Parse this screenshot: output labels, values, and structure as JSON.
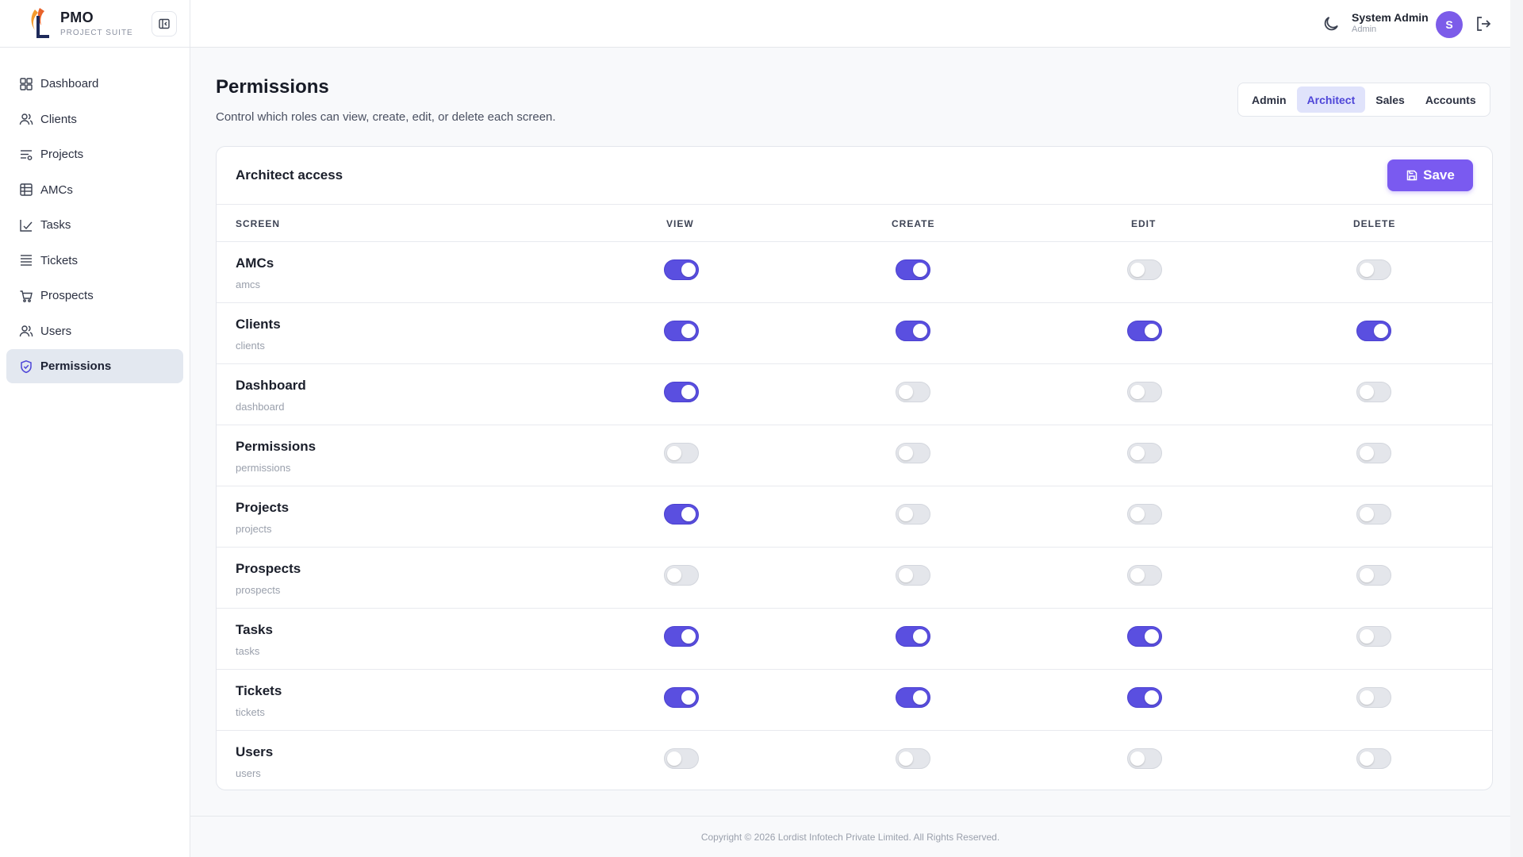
{
  "brand": {
    "title": "PMO",
    "subtitle": "PROJECT SUITE"
  },
  "sidebar": {
    "items": [
      {
        "label": "Dashboard",
        "icon": "grid-icon",
        "active": false
      },
      {
        "label": "Clients",
        "icon": "users-icon",
        "active": false
      },
      {
        "label": "Projects",
        "icon": "projects-icon",
        "active": false
      },
      {
        "label": "AMCs",
        "icon": "table-icon",
        "active": false
      },
      {
        "label": "Tasks",
        "icon": "checklist-icon",
        "active": false
      },
      {
        "label": "Tickets",
        "icon": "tickets-icon",
        "active": false
      },
      {
        "label": "Prospects",
        "icon": "cart-icon",
        "active": false
      },
      {
        "label": "Users",
        "icon": "users-icon",
        "active": false
      },
      {
        "label": "Permissions",
        "icon": "shield-icon",
        "active": true
      }
    ]
  },
  "header": {
    "user_name": "System Admin",
    "user_role": "Admin",
    "avatar_initial": "S"
  },
  "page": {
    "title": "Permissions",
    "description": "Control which roles can view, create, edit, or delete each screen."
  },
  "roles": [
    {
      "label": "Admin",
      "active": false
    },
    {
      "label": "Architect",
      "active": true
    },
    {
      "label": "Sales",
      "active": false
    },
    {
      "label": "Accounts",
      "active": false
    }
  ],
  "card": {
    "title": "Architect access",
    "save_label": "Save",
    "columns": [
      "SCREEN",
      "VIEW",
      "CREATE",
      "EDIT",
      "DELETE"
    ]
  },
  "permissions": [
    {
      "name": "AMCs",
      "key": "amcs",
      "view": true,
      "create": true,
      "edit": false,
      "delete": false
    },
    {
      "name": "Clients",
      "key": "clients",
      "view": true,
      "create": true,
      "edit": true,
      "delete": true
    },
    {
      "name": "Dashboard",
      "key": "dashboard",
      "view": true,
      "create": false,
      "edit": false,
      "delete": false
    },
    {
      "name": "Permissions",
      "key": "permissions",
      "view": false,
      "create": false,
      "edit": false,
      "delete": false
    },
    {
      "name": "Projects",
      "key": "projects",
      "view": true,
      "create": false,
      "edit": false,
      "delete": false
    },
    {
      "name": "Prospects",
      "key": "prospects",
      "view": false,
      "create": false,
      "edit": false,
      "delete": false
    },
    {
      "name": "Tasks",
      "key": "tasks",
      "view": true,
      "create": true,
      "edit": true,
      "delete": false
    },
    {
      "name": "Tickets",
      "key": "tickets",
      "view": true,
      "create": true,
      "edit": true,
      "delete": false
    },
    {
      "name": "Users",
      "key": "users",
      "view": false,
      "create": false,
      "edit": false,
      "delete": false
    }
  ],
  "footer": {
    "text": "Copyright © 2026 Lordist Infotech Private Limited. All Rights Reserved."
  },
  "colors": {
    "accent": "#5a4fe0",
    "save_button": "#7a5af0",
    "active_nav": "#e3e8f0",
    "avatar": "#7c5ce9"
  }
}
